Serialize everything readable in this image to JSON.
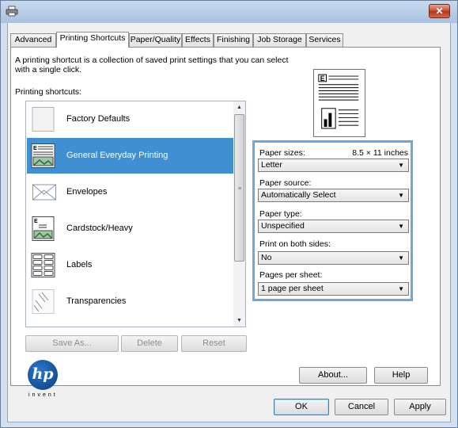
{
  "window": {
    "close_glyph": "✕",
    "app_icon": "printer-icon"
  },
  "tabs": [
    {
      "label": "Advanced"
    },
    {
      "label": "Printing Shortcuts"
    },
    {
      "label": "Paper/Quality"
    },
    {
      "label": "Effects"
    },
    {
      "label": "Finishing"
    },
    {
      "label": "Job Storage"
    },
    {
      "label": "Services"
    }
  ],
  "active_tab": "Printing Shortcuts",
  "description": "A printing shortcut is a collection of saved print settings that you can select with a single click.",
  "shortcuts_label": "Printing shortcuts:",
  "shortcuts": [
    {
      "label": "Factory Defaults",
      "icon": "blank-page-icon"
    },
    {
      "label": "General Everyday Printing",
      "icon": "document-icon",
      "selected": true
    },
    {
      "label": "Envelopes",
      "icon": "envelope-icon"
    },
    {
      "label": "Cardstock/Heavy",
      "icon": "card-icon"
    },
    {
      "label": "Labels",
      "icon": "labels-icon"
    },
    {
      "label": "Transparencies",
      "icon": "transparency-icon"
    }
  ],
  "settings": {
    "paper_sizes_label": "Paper sizes:",
    "paper_sizes_value": "8.5 × 11 inches",
    "paper_size_select": "Letter",
    "paper_source_label": "Paper source:",
    "paper_source_select": "Automatically Select",
    "paper_type_label": "Paper type:",
    "paper_type_select": "Unspecified",
    "duplex_label": "Print on both sides:",
    "duplex_select": "No",
    "pages_label": "Pages per sheet:",
    "pages_select": "1 page per sheet"
  },
  "buttons": {
    "save_as": "Save As...",
    "delete": "Delete",
    "reset": "Reset",
    "about": "About...",
    "help": "Help",
    "ok": "OK",
    "cancel": "Cancel",
    "apply": "Apply"
  },
  "logo": {
    "text": "hp",
    "tagline": "invent"
  },
  "colors": {
    "selection": "#3f8fd2",
    "settings_border": "#6ea8d8",
    "close": "#c9462c"
  }
}
